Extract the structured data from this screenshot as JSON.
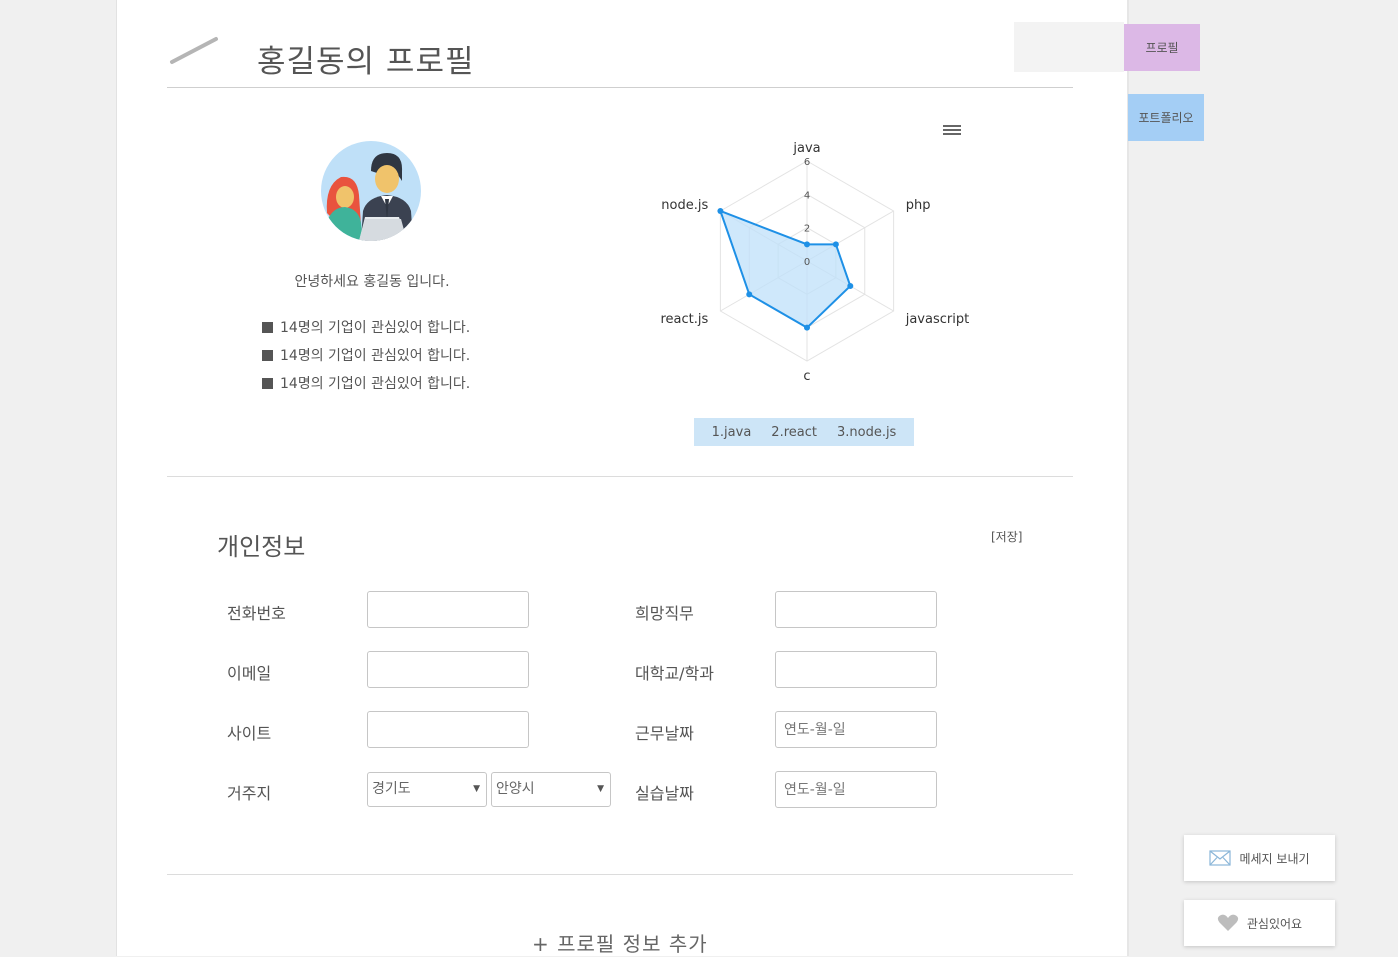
{
  "header": {
    "title": "홍길동의 프로필"
  },
  "profile": {
    "greeting": "안녕하세요 홍길동 입니다.",
    "interests": [
      "14명의 기업이 관심있어 합니다.",
      "14명의 기업이 관심있어 합니다.",
      "14명의 기업이 관심있어 합니다."
    ]
  },
  "chart_data": {
    "type": "radar",
    "categories": [
      "java",
      "php",
      "javascript",
      "c",
      "react.js",
      "node.js"
    ],
    "values": [
      1,
      2,
      3,
      4,
      4,
      6
    ],
    "radial_ticks": [
      "0",
      "2",
      "4",
      "6"
    ],
    "rmax": 6,
    "colors": {
      "line": "#1e90e6",
      "fill": "#bfe0fa",
      "grid": "#e3e3e3"
    },
    "legend": [
      "1.java",
      "2.react",
      "3.node.js"
    ]
  },
  "info": {
    "title": "개인정보",
    "save_label": "[저장]",
    "labels": {
      "phone": "전화번호",
      "email": "이메일",
      "site": "사이트",
      "address": "거주지",
      "job": "희망직무",
      "school": "대학교/학과",
      "work_date": "근무날짜",
      "intern_date": "실습날짜"
    },
    "date_placeholder": "연도-월-일",
    "province": "경기도",
    "city": "안양시"
  },
  "add_profile_label": "+ 프로필 정보 추가",
  "side_nav": {
    "profile": "프로필",
    "portfolio": "포트폴리오",
    "colors": {
      "profile_bg": "#dcb8e6",
      "portfolio_bg": "#a4cef5"
    }
  },
  "actions": {
    "message": "메세지 보내기",
    "interest": "관심있어요"
  }
}
